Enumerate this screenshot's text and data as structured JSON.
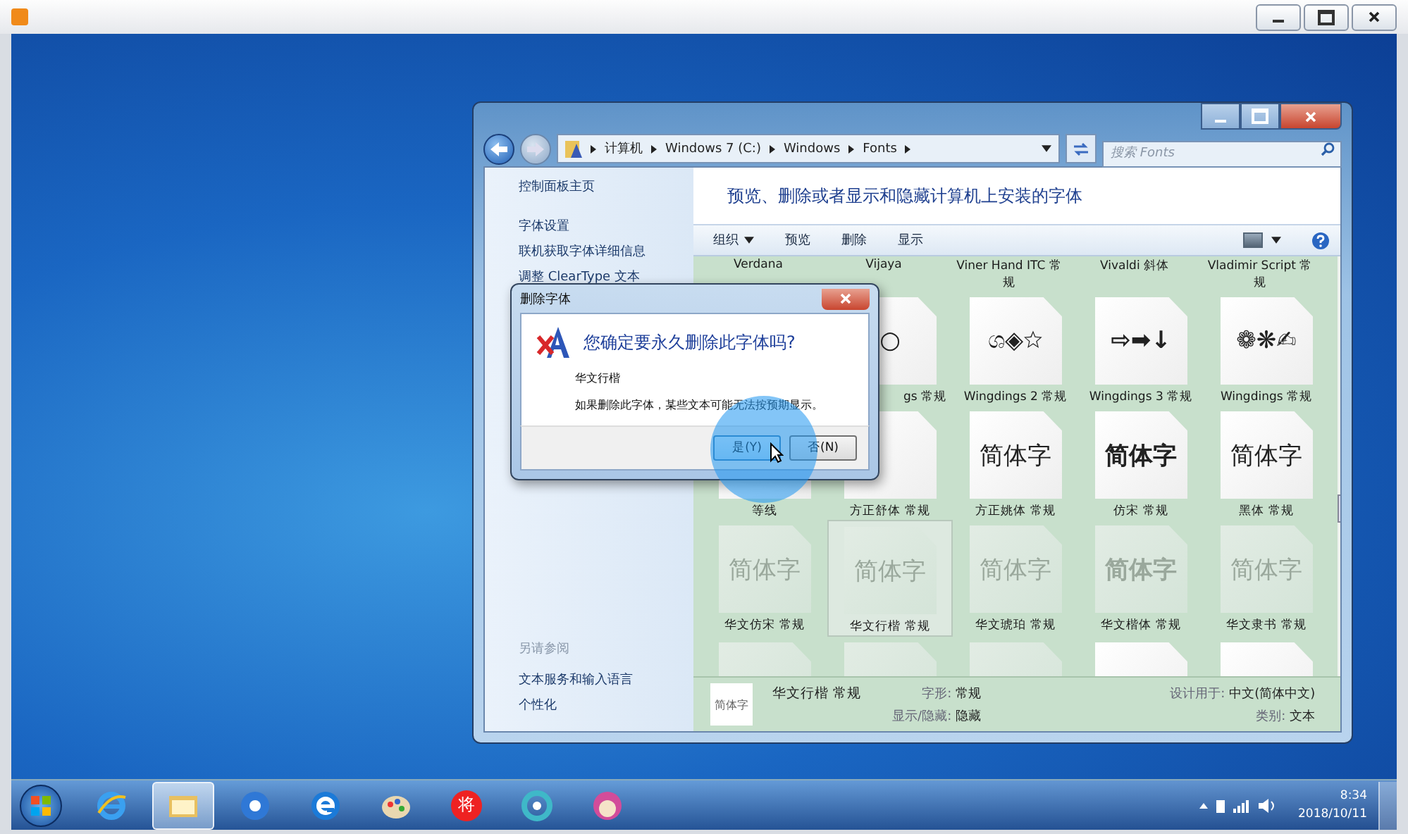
{
  "explorer": {
    "breadcrumb": [
      "计算机",
      "Windows 7 (C:)",
      "Windows",
      "Fonts"
    ],
    "search": {
      "placeholder": "搜索 Fonts"
    },
    "sidebar": {
      "links": [
        "控制面板主页",
        "字体设置",
        "联机获取字体详细信息",
        "调整 ClearType 文本"
      ],
      "see_also_heading": "另请参阅",
      "see_also": [
        "文本服务和输入语言",
        "个性化"
      ]
    },
    "heading": "预览、删除或者显示和隐藏计算机上安装的字体",
    "toolbar": [
      {
        "label": "组织",
        "dropdown": true
      },
      {
        "label": "预览",
        "dropdown": false
      },
      {
        "label": "删除",
        "dropdown": false
      },
      {
        "label": "显示",
        "dropdown": false
      }
    ],
    "label_row": [
      "Verdana",
      "Vijaya",
      "Viner Hand ITC 常规",
      "Vivaldi 斜体",
      "Vladimir Script 常规"
    ],
    "rows": [
      [
        {},
        {
          "glyph": "○",
          "label": "gs 常规",
          "cut": true,
          "hidden": false,
          "selected": false
        },
        {
          "glyph": "ශ◈☆",
          "label": "Wingdings 2 常规",
          "hidden": false,
          "selected": false
        },
        {
          "glyph": "⇨➡↓",
          "label": "Wingdings 3 常规",
          "hidden": false,
          "selected": false
        },
        {
          "glyph": "❁❋✍",
          "label": "Wingdings 常规",
          "hidden": false,
          "selected": false
        }
      ],
      [
        {
          "label": "等线",
          "hidden": false,
          "selected": false
        },
        {
          "label": "方正舒体 常规",
          "hidden": false,
          "selected": false
        },
        {
          "glyph": "简体字",
          "label": "方正姚体 常规",
          "hidden": false,
          "selected": false
        },
        {
          "glyph": "简体字",
          "label": "仿宋 常规",
          "hidden": false,
          "selected": false
        },
        {
          "glyph": "简体字",
          "label": "黑体 常规",
          "hidden": false,
          "selected": false
        }
      ],
      [
        {
          "glyph": "简体字",
          "label": "华文仿宋 常规",
          "hidden": true,
          "selected": false
        },
        {
          "glyph": "简体字",
          "label": "华文行楷 常规",
          "hidden": true,
          "selected": true
        },
        {
          "glyph": "简体字",
          "label": "华文琥珀 常规",
          "hidden": true,
          "selected": false
        },
        {
          "glyph": "简体字",
          "label": "华文楷体 常规",
          "hidden": true,
          "selected": false
        },
        {
          "glyph": "简体字",
          "label": "华文隶书 常规",
          "hidden": true,
          "selected": false
        }
      ],
      [
        {
          "hidden": true,
          "selected": false
        },
        {
          "hidden": true,
          "selected": false
        },
        {
          "hidden": true,
          "selected": false
        },
        {
          "hidden": false,
          "selected": false
        },
        {
          "hidden": false,
          "selected": false
        }
      ]
    ],
    "details": {
      "thumb": "简体字",
      "name": "华文行楷 常规",
      "fields_left": [
        {
          "key": "字形:",
          "value": "常规"
        },
        {
          "key": "显示/隐藏:",
          "value": "隐藏"
        }
      ],
      "fields_right": [
        {
          "key": "设计用于:",
          "value": "中文(简体中文)"
        },
        {
          "key": "类别:",
          "value": "文本"
        }
      ]
    }
  },
  "dialog": {
    "title": "删除字体",
    "question": "您确定要永久删除此字体吗?",
    "font_name": "华文行楷",
    "message": "如果删除此字体，某些文本可能无法按预期显示。",
    "buttons": [
      {
        "label": "是(Y)",
        "selected": true
      },
      {
        "label": "否(N)",
        "selected": false
      }
    ]
  },
  "taskbar": {
    "apps": [
      {
        "kind": "ie",
        "active": false
      },
      {
        "kind": "folder",
        "active": true
      },
      {
        "kind": "media",
        "active": false
      },
      {
        "kind": "ie2",
        "active": false
      },
      {
        "kind": "paint",
        "active": false
      },
      {
        "kind": "char",
        "glyph": "将",
        "active": false
      },
      {
        "kind": "swirl",
        "active": false
      },
      {
        "kind": "face",
        "active": false
      }
    ],
    "time": "8:34",
    "date": "2018/10/11"
  }
}
